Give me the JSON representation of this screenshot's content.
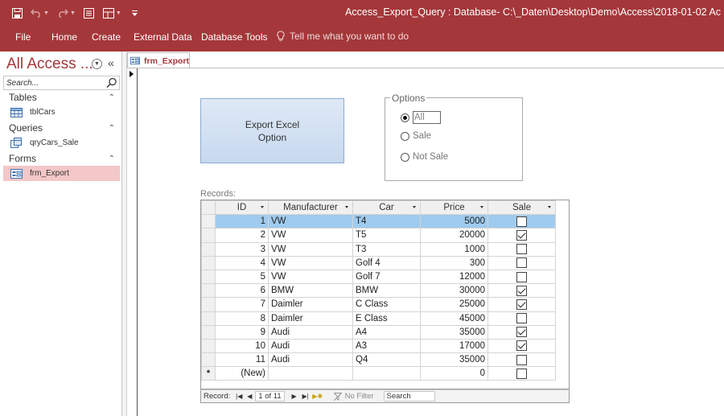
{
  "window": {
    "title": "Access_Export_Query : Database- C:\\_Daten\\Desktop\\Demo\\Access\\2018-01-02 Ac",
    "accent_color": "#a4373a",
    "quick_access_icons": [
      "save-icon",
      "undo-icon",
      "redo-icon",
      "form-view-icon",
      "layout-icon",
      "customize-icon"
    ]
  },
  "ribbon": {
    "tabs": [
      "File",
      "Home",
      "Create",
      "External Data",
      "Database Tools"
    ],
    "tell_me": "Tell me what you want to do"
  },
  "nav": {
    "title": "All Access ...",
    "search_placeholder": "Search...",
    "groups": [
      {
        "name": "Tables",
        "items": [
          {
            "label": "tblCars",
            "icon": "table-icon"
          }
        ]
      },
      {
        "name": "Queries",
        "items": [
          {
            "label": "qryCars_Sale",
            "icon": "query-icon"
          }
        ]
      },
      {
        "name": "Forms",
        "items": [
          {
            "label": "frm_Export",
            "icon": "form-icon",
            "selected": true
          }
        ]
      }
    ]
  },
  "document": {
    "tab_label": "frm_Export",
    "export_button": "Export Excel\nOption",
    "options": {
      "legend": "Options",
      "choices": [
        "All",
        "Sale",
        "Not Sale"
      ],
      "selected": "All"
    },
    "records_label": "Records:",
    "columns": [
      "ID",
      "Manufacturer",
      "Car",
      "Price",
      "Sale"
    ],
    "rows": [
      {
        "id": "1",
        "manufacturer": "VW",
        "car": "T4",
        "price": "5000",
        "sale": false
      },
      {
        "id": "2",
        "manufacturer": "VW",
        "car": "T5",
        "price": "20000",
        "sale": true
      },
      {
        "id": "3",
        "manufacturer": "VW",
        "car": "T3",
        "price": "1000",
        "sale": false
      },
      {
        "id": "4",
        "manufacturer": "VW",
        "car": "Golf 4",
        "price": "300",
        "sale": false
      },
      {
        "id": "5",
        "manufacturer": "VW",
        "car": "Golf 7",
        "price": "12000",
        "sale": false
      },
      {
        "id": "6",
        "manufacturer": "BMW",
        "car": "BMW",
        "price": "30000",
        "sale": true
      },
      {
        "id": "7",
        "manufacturer": "Daimler",
        "car": "C Class",
        "price": "25000",
        "sale": true
      },
      {
        "id": "8",
        "manufacturer": "Daimler",
        "car": "E Class",
        "price": "45000",
        "sale": false
      },
      {
        "id": "9",
        "manufacturer": "Audi",
        "car": "A4",
        "price": "35000",
        "sale": true
      },
      {
        "id": "10",
        "manufacturer": "Audi",
        "car": "A3",
        "price": "17000",
        "sale": true
      },
      {
        "id": "11",
        "manufacturer": "Audi",
        "car": "Q4",
        "price": "35000",
        "sale": false
      }
    ],
    "new_row": {
      "marker": "*",
      "id": "(New)",
      "price": "0"
    },
    "current_row": 0,
    "navbar": {
      "label": "Record:",
      "position": "1 of 11",
      "no_filter": "No Filter",
      "search_placeholder": "Search"
    }
  }
}
